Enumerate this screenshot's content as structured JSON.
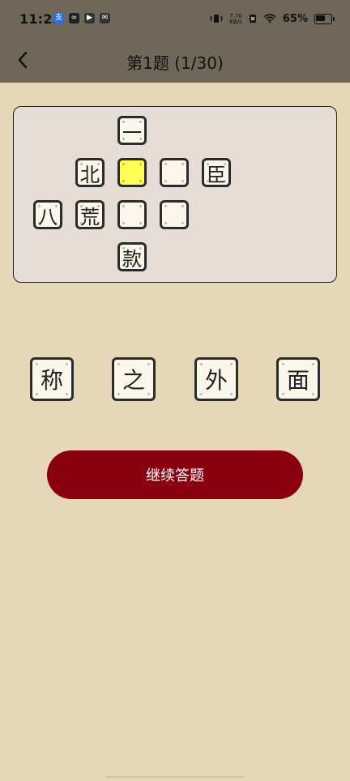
{
  "status_bar": {
    "time": "11:25",
    "left_icons": [
      {
        "name": "alipay-icon",
        "glyph": "支",
        "style": "blue"
      },
      {
        "name": "app-icon",
        "glyph": "∞",
        "style": "dark"
      },
      {
        "name": "play-icon",
        "glyph": "▶",
        "style": "gray"
      },
      {
        "name": "mail-icon",
        "glyph": "✉",
        "style": "gray"
      }
    ],
    "net_speed_value": "7.70",
    "net_speed_unit": "KB/s",
    "battery_percent": "65%",
    "battery_level": 0.65
  },
  "nav": {
    "title": "第1题 (1/30)"
  },
  "puzzle": {
    "tiles": [
      {
        "id": "r0c2",
        "text": "一",
        "state": "filled"
      },
      {
        "id": "r1c1",
        "text": "北",
        "state": "filled"
      },
      {
        "id": "r1c2",
        "text": "",
        "state": "selected"
      },
      {
        "id": "r1c3",
        "text": "",
        "state": "empty"
      },
      {
        "id": "r1c4",
        "text": "臣",
        "state": "filled"
      },
      {
        "id": "r2c0",
        "text": "八",
        "state": "filled"
      },
      {
        "id": "r2c1",
        "text": "荒",
        "state": "filled"
      },
      {
        "id": "r2c2",
        "text": "",
        "state": "empty"
      },
      {
        "id": "r2c3",
        "text": "",
        "state": "empty"
      },
      {
        "id": "r3c2",
        "text": "款",
        "state": "filled"
      }
    ]
  },
  "choices": [
    "称",
    "之",
    "外",
    "面"
  ],
  "actions": {
    "continue_label": "继续答题"
  },
  "colors": {
    "background": "#e6d7b8",
    "top_bar": "#6f6758",
    "highlight": "#ffff55",
    "button": "#8b0010"
  }
}
